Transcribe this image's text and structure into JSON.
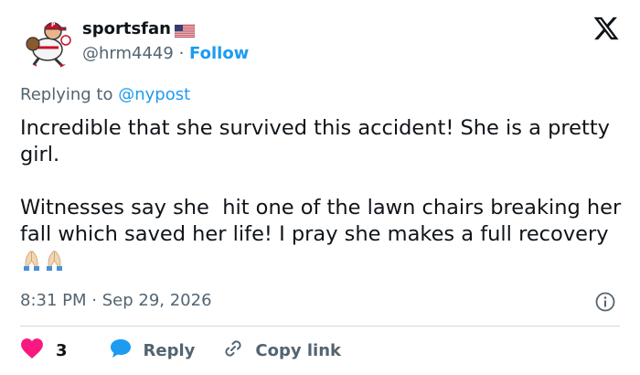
{
  "user": {
    "display_name": "sportsfan",
    "handle": "@hrm4449",
    "separator": "·",
    "follow_label": "Follow",
    "flag_icon": "us-flag-icon",
    "avatar_icon": "baseball-player-avatar"
  },
  "reply": {
    "prefix": "Replying to",
    "mention": "@nypost"
  },
  "tweet": {
    "line1": "Incredible that she survived this accident! She is a pretty girl.",
    "line2": "Witnesses say she  hit one of the lawn chairs breaking her fall which saved her life! I pray she makes a full recovery",
    "emoji": "praying-hands-icon"
  },
  "meta": {
    "time": "8:31 PM",
    "separator": "·",
    "date": "Sep 29, 2026"
  },
  "actions": {
    "like_count": "3",
    "reply_label": "Reply",
    "copy_label": "Copy link"
  },
  "colors": {
    "accent": "#1d9bf0",
    "muted": "#536471",
    "like": "#f91880",
    "divider": "#cfd9de"
  }
}
